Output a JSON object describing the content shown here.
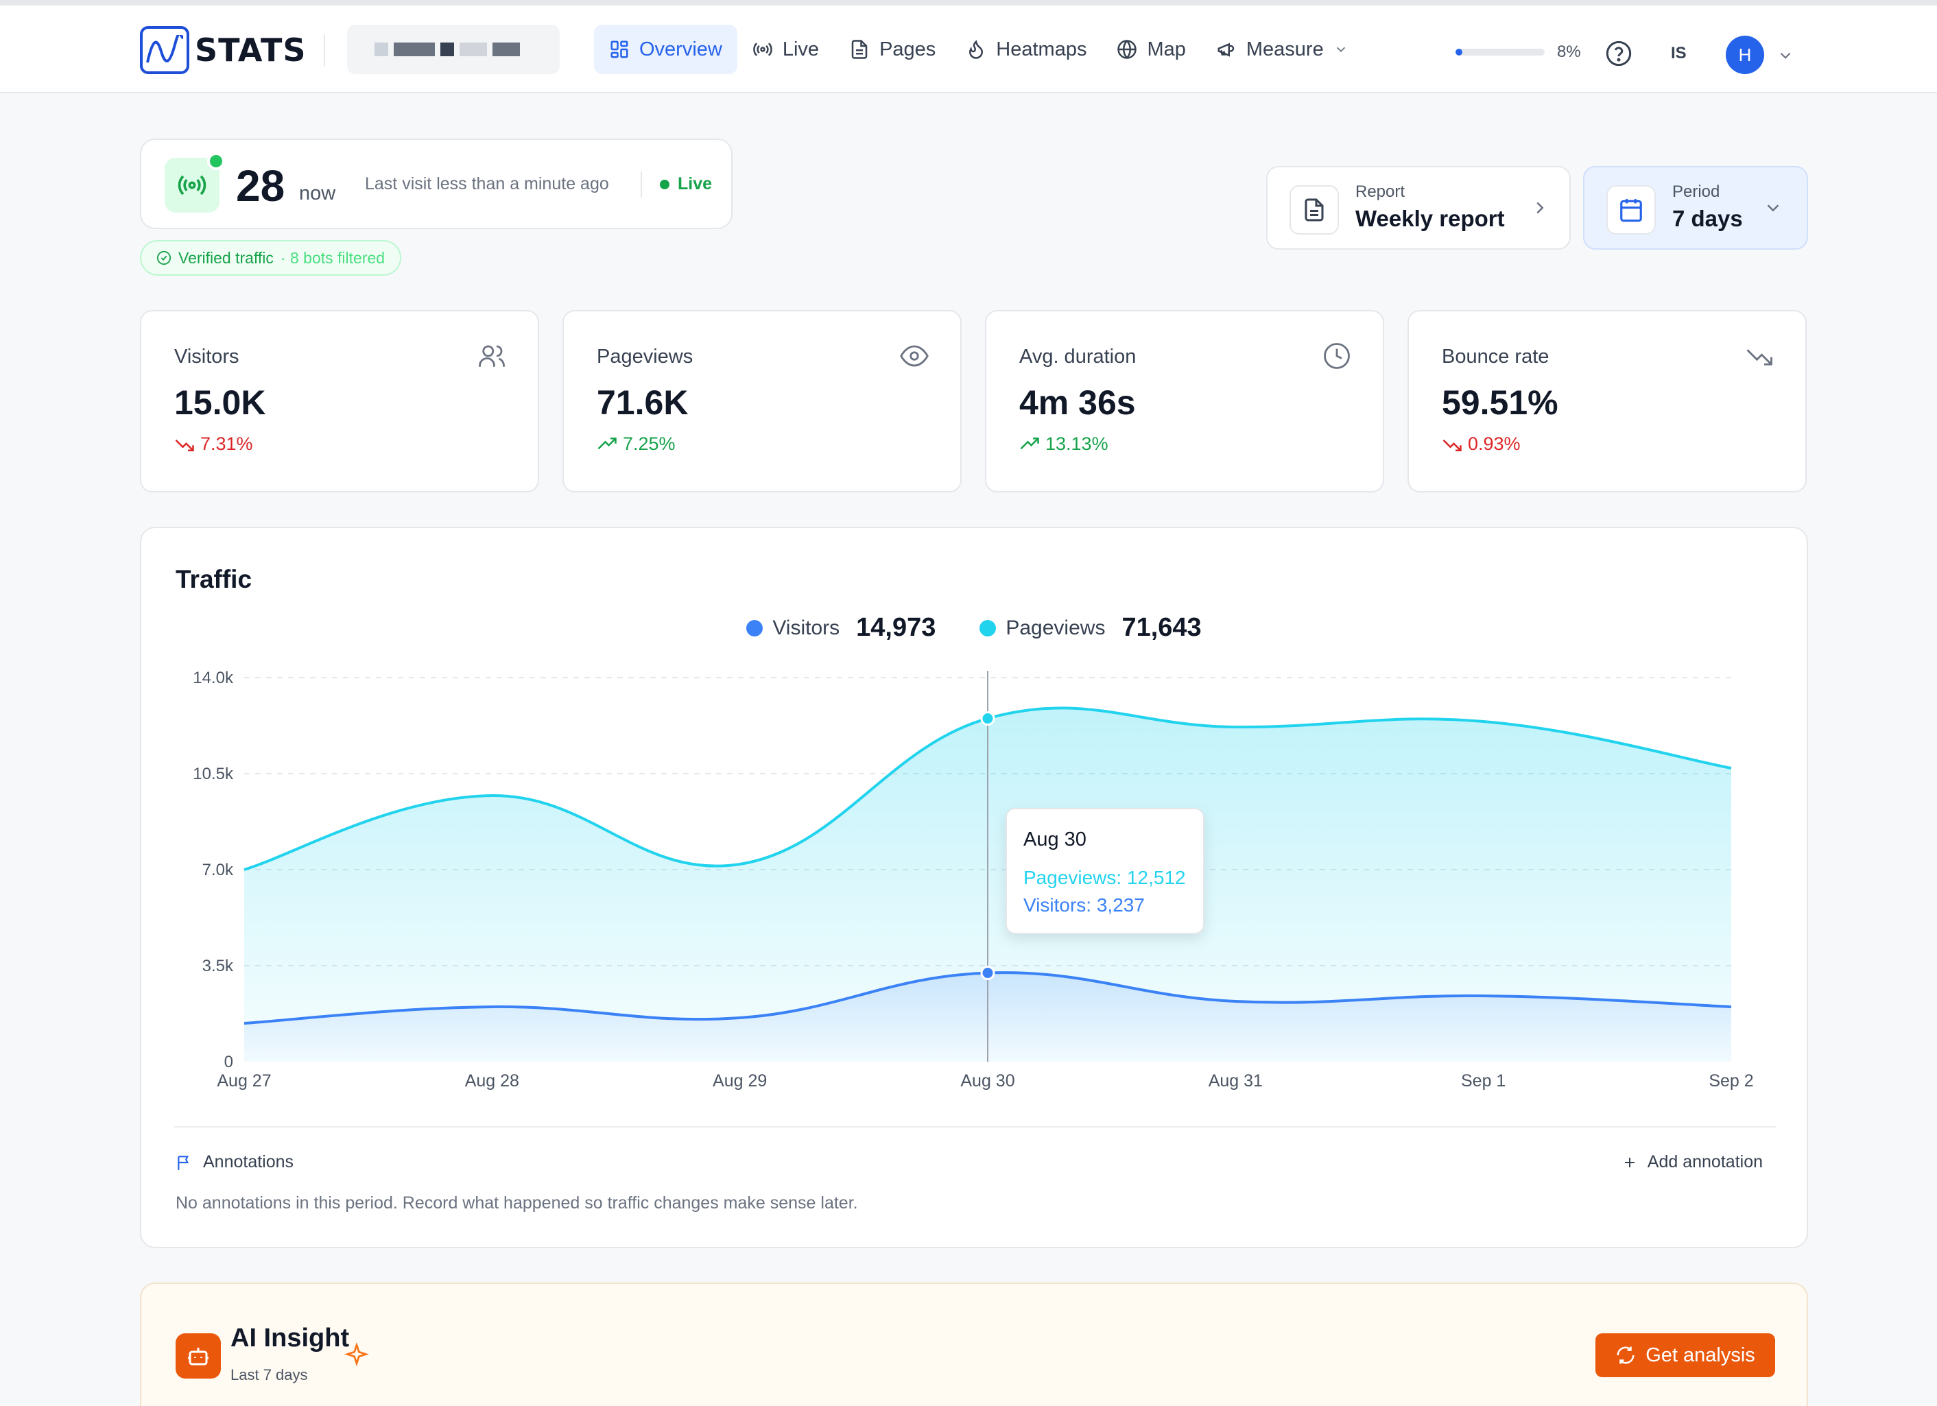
{
  "app": {
    "name": "STATS"
  },
  "nav": {
    "items": [
      {
        "label": "Overview",
        "icon": "grid-icon",
        "active": true
      },
      {
        "label": "Live",
        "icon": "broadcast-icon"
      },
      {
        "label": "Pages",
        "icon": "document-icon"
      },
      {
        "label": "Heatmaps",
        "icon": "flame-icon"
      },
      {
        "label": "Map",
        "icon": "globe-icon"
      },
      {
        "label": "Measure",
        "icon": "megaphone-icon"
      }
    ]
  },
  "usage": {
    "percent_label": "8%",
    "fraction": 0.08
  },
  "lang": "IS",
  "user": {
    "initial": "H"
  },
  "live": {
    "count": "28",
    "now_label": "now",
    "last_visit": "Last visit less than a minute ago",
    "badge": "Live"
  },
  "verified": {
    "label": "Verified traffic",
    "bots": "· 8 bots filtered"
  },
  "report": {
    "label": "Report",
    "value": "Weekly report"
  },
  "period": {
    "label": "Period",
    "value": "7 days"
  },
  "stats": [
    {
      "label": "Visitors",
      "value": "15.0K",
      "delta": "7.31%",
      "trend": "down",
      "icon": "users-icon"
    },
    {
      "label": "Pageviews",
      "value": "71.6K",
      "delta": "7.25%",
      "trend": "up",
      "icon": "eye-icon"
    },
    {
      "label": "Avg. duration",
      "value": "4m 36s",
      "delta": "13.13%",
      "trend": "up",
      "icon": "clock-icon"
    },
    {
      "label": "Bounce rate",
      "value": "59.51%",
      "delta": "0.93%",
      "trend": "down",
      "icon": "trending-down-icon"
    }
  ],
  "traffic": {
    "title": "Traffic",
    "legend": [
      {
        "name": "Visitors",
        "total": "14,973",
        "color": "#3b82f6"
      },
      {
        "name": "Pageviews",
        "total": "71,643",
        "color": "#22d3ee"
      }
    ],
    "tooltip": {
      "date": "Aug 30",
      "pageviews": "Pageviews: 12,512",
      "visitors": "Visitors: 3,237"
    },
    "annotations_title": "Annotations",
    "add_annotation": "Add annotation",
    "annotations_empty": "No annotations in this period. Record what happened so traffic changes make sense later."
  },
  "chart_data": {
    "type": "area",
    "categories": [
      "Aug 27",
      "Aug 28",
      "Aug 29",
      "Aug 30",
      "Aug 31",
      "Sep 1",
      "Sep 2"
    ],
    "series": [
      {
        "name": "Pageviews",
        "color": "#22d3ee",
        "values": [
          7000,
          9700,
          7200,
          12512,
          12200,
          12400,
          10700
        ]
      },
      {
        "name": "Visitors",
        "color": "#3b82f6",
        "values": [
          1400,
          2000,
          1600,
          3237,
          2200,
          2400,
          2000
        ]
      }
    ],
    "yticks": [
      "0",
      "3.5k",
      "7.0k",
      "10.5k",
      "14.0k"
    ],
    "ylim": [
      0,
      14000
    ],
    "highlight_index": 3
  },
  "ai": {
    "title": "AI Insight",
    "subtitle": "Last 7 days",
    "button": "Get analysis"
  }
}
